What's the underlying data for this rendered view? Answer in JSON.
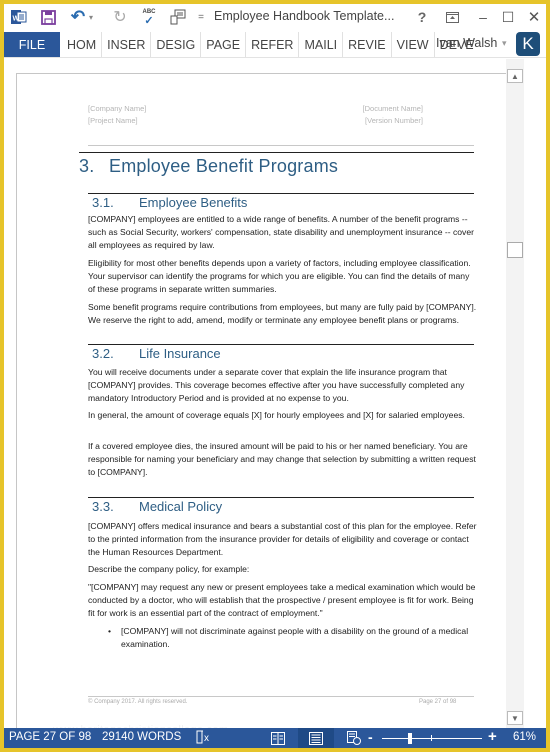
{
  "window": {
    "title": "Employee Handbook Template...",
    "help": "?",
    "restore_ribbon": "⤒",
    "minimize": "–",
    "maximize": "☐",
    "close": "✕"
  },
  "quick_access": {
    "word_icon": "W",
    "save_icon": "save",
    "undo_icon": "↶",
    "undo_dropdown": "▾",
    "redo_icon": "↻",
    "spelling_icon": "ABC",
    "customize": "="
  },
  "ribbon": {
    "file_label": "FILE",
    "tabs": [
      {
        "label": "HOM"
      },
      {
        "label": "INSER"
      },
      {
        "label": "DESIG"
      },
      {
        "label": "PAGE"
      },
      {
        "label": "REFER"
      },
      {
        "label": "MAILI"
      },
      {
        "label": "REVIE"
      },
      {
        "label": "VIEW"
      },
      {
        "label": "DEVE"
      }
    ],
    "user_name": "Ivan Walsh",
    "user_caret": "▾",
    "avatar_letter": "K"
  },
  "document": {
    "header": {
      "company_name": "[Company Name]",
      "project_name": "[Project Name]",
      "document_name": "[Document Name]",
      "version_number": "[Version Number]"
    },
    "heading1": {
      "number": "3.",
      "title": "Employee Benefit Programs"
    },
    "sections": [
      {
        "number": "3.1.",
        "title": "Employee Benefits",
        "paragraphs": [
          "[COMPANY] employees are entitled to a wide range of benefits. A number of the benefit programs -- such as Social Security, workers' compensation, state disability and unemployment insurance -- cover all employees as required by law.",
          "Eligibility for most other benefits depends upon a variety of factors, including employee classification. Your supervisor can identify the programs for which you are eligible. You can find the details of many of these programs in separate written summaries.",
          "Some benefit programs require contributions from employees, but many are fully paid by [COMPANY]. We reserve the right to add, amend, modify or terminate any employee benefit plans or programs."
        ]
      },
      {
        "number": "3.2.",
        "title": "Life Insurance",
        "paragraphs": [
          "You will receive documents under a separate cover that explain the life insurance program that [COMPANY] provides. This coverage becomes effective after you have successfully completed any mandatory Introductory Period and is provided at no expense to you.",
          "In general, the amount of coverage equals [X] for hourly employees and [X] for salaried employees.",
          "If a covered employee dies, the insured amount will be paid to his or her named beneficiary. You are responsible for naming your beneficiary and may change that selection by submitting a written request to [COMPANY]."
        ]
      },
      {
        "number": "3.3.",
        "title": "Medical Policy",
        "paragraphs": [
          "[COMPANY] offers medical insurance and bears a substantial cost of this plan for the employee. Refer to the printed information from the insurance provider for details of eligibility and coverage or contact the Human Resources Department.",
          "Describe the company policy, for example:",
          "\"[COMPANY] may request any new or present employees take a medical examination which would be conducted by a doctor, who will establish that the prospective / present employee is fit for work. Being fit for work is an essential part of the contract of employment.\""
        ],
        "bullets": [
          "[COMPANY] will not discriminate against people with a disability on the ground of a medical examination."
        ]
      }
    ],
    "footer": {
      "copyright": "© Company 2017. All rights reserved.",
      "page": "Page 27 of 98"
    },
    "watermark": "www.heritagechristiancollege.com"
  },
  "status_bar": {
    "page": "PAGE 27 OF 98",
    "words": "29140 WORDS",
    "proofing_icon": "proofing-error",
    "views": [
      "read-mode",
      "print-layout",
      "web-layout"
    ],
    "active_view": "print-layout",
    "zoom_minus": "-",
    "zoom_plus": "+",
    "zoom_level": "61%",
    "zoom_percent_value": 61
  },
  "colors": {
    "accent": "#2b579a",
    "heading": "#2e5e84",
    "window_border": "#e6c42a",
    "avatar": "#1e4e79"
  }
}
